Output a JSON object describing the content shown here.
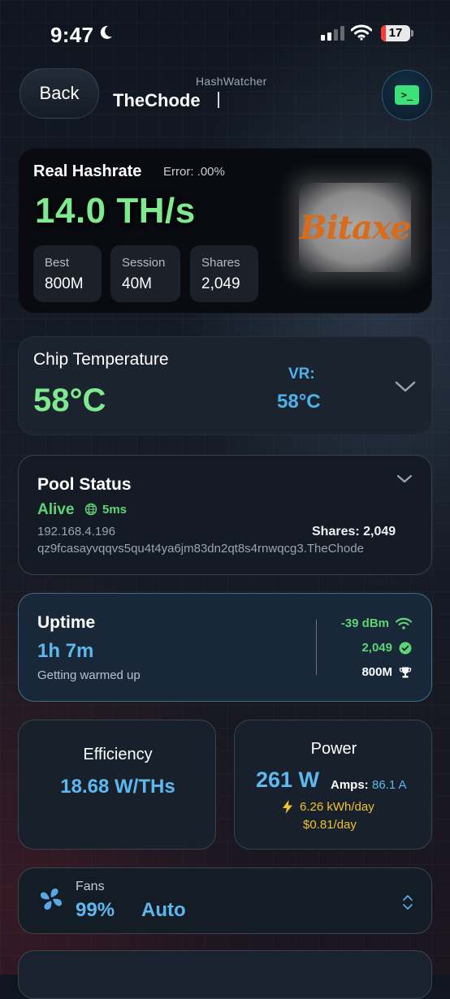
{
  "status_bar": {
    "time": "9:47",
    "battery": "17",
    "battery_level": 0.17
  },
  "header": {
    "back_label": "Back",
    "app_name": "HashWatcher",
    "device_name": "TheChode",
    "terminal_icon": "terminal-icon"
  },
  "hashrate": {
    "title": "Real Hashrate",
    "error": "Error: .00%",
    "value": "14.0 TH/s",
    "logo_text": "Bitaxe",
    "stats": [
      {
        "label": "Best",
        "value": "800M"
      },
      {
        "label": "Session",
        "value": "40M"
      },
      {
        "label": "Shares",
        "value": "2,049"
      }
    ]
  },
  "chip_temp": {
    "title": "Chip Temperature",
    "value": "58°C",
    "vr_label": "VR:",
    "vr_value": "58°C"
  },
  "pool": {
    "title": "Pool Status",
    "state": "Alive",
    "ping": "5ms",
    "ip": "192.168.4.196",
    "shares": "Shares: 2,049",
    "address": "qz9fcasayvqqvs5qu4t4ya6jm83dn2qt8s4rnwqcg3.TheChode"
  },
  "uptime": {
    "title": "Uptime",
    "value": "1h 7m",
    "subtitle": "Getting warmed up",
    "signal": "-39 dBm",
    "shares": "2,049",
    "best": "800M"
  },
  "efficiency": {
    "title": "Efficiency",
    "value": "18.68 W/THs"
  },
  "power": {
    "title": "Power",
    "watts": "261 W",
    "amps_label": "Amps:",
    "amps_value": "86.1 A",
    "kwh": "6.26 kWh/day",
    "cost": "$0.81/day"
  },
  "fans": {
    "label": "Fans",
    "percent": "99%",
    "mode": "Auto"
  },
  "colors": {
    "green": "#7ee98e",
    "blue": "#5cb8ee",
    "yellow": "#f1c232",
    "accent_border": "#78bee6"
  }
}
